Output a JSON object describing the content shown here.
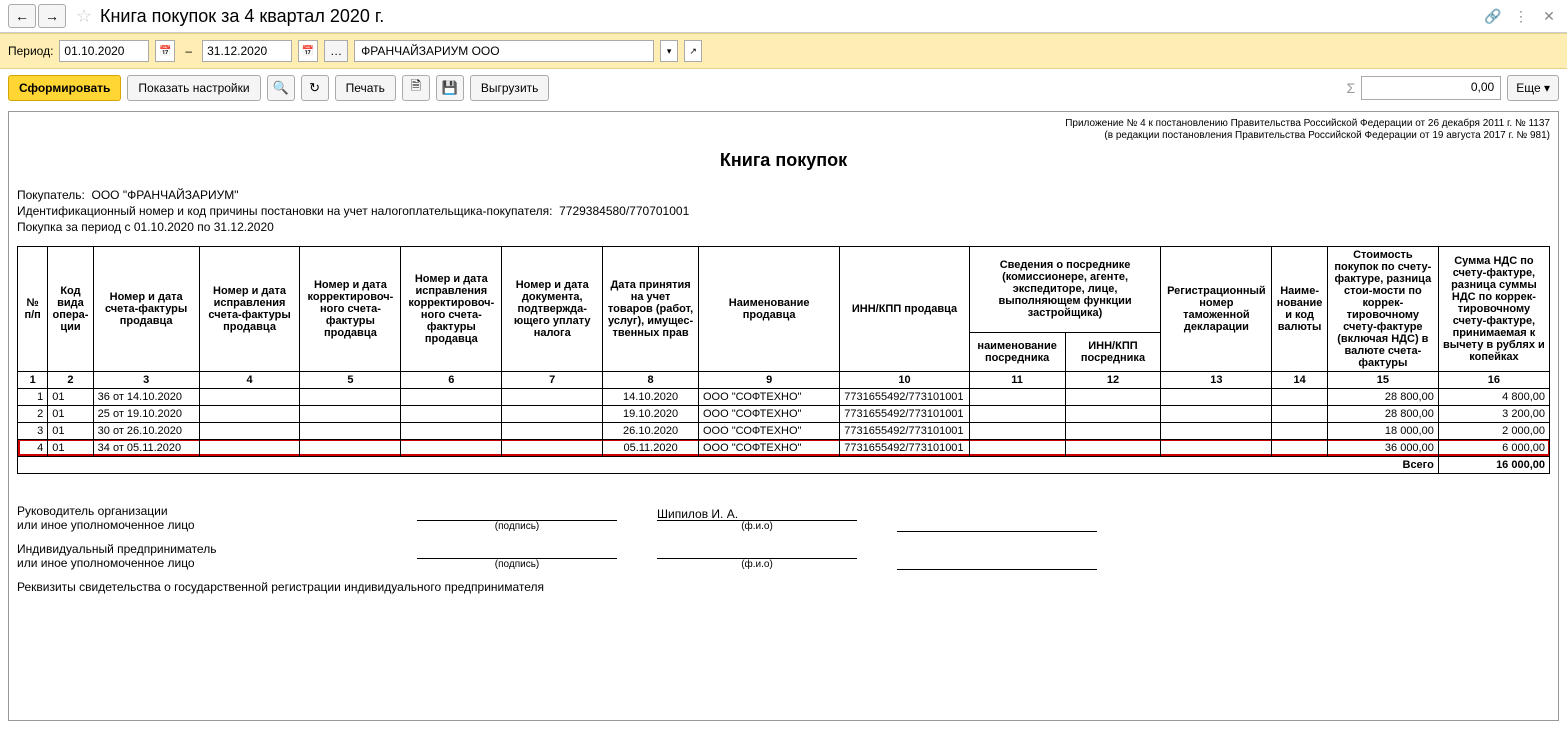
{
  "title": "Книга покупок за 4 квартал 2020 г.",
  "period": {
    "label": "Период:",
    "from": "01.10.2020",
    "to": "31.12.2020",
    "dash": "–"
  },
  "org_input": "ФРАНЧАЙЗАРИУМ ООО",
  "toolbar": {
    "form": "Сформировать",
    "show_settings": "Показать настройки",
    "print": "Печать",
    "export": "Выгрузить",
    "more": "Еще",
    "sum": "0,00"
  },
  "report": {
    "legal1": "Приложение № 4 к постановлению Правительства Российской Федерации от 26 декабря 2011 г. № 1137",
    "legal2": "(в редакции постановления Правительства Российской Федерации от 19 августа 2017 г. № 981)",
    "title": "Книга покупок",
    "buyer_label": "Покупатель:",
    "buyer": "ООО \"ФРАНЧАЙЗАРИУМ\"",
    "inn_label": "Идентификационный номер и код причины постановки на учет налогоплательщика-покупателя:",
    "inn": "7729384580/770701001",
    "period_label": "Покупка за период с 01.10.2020 по 31.12.2020",
    "headers": {
      "h1": "№ п/п",
      "h2": "Код вида опера-ции",
      "h3": "Номер и дата счета-фактуры продавца",
      "h4": "Номер и дата исправления счета-фактуры продавца",
      "h5": "Номер и дата корректировоч-ного счета-фактуры продавца",
      "h6": "Номер и дата исправления корректировоч-ного счета-фактуры продавца",
      "h7": "Номер и дата документа, подтвержда-ющего уплату налога",
      "h8": "Дата принятия на учет товаров (работ, услуг), имущес-твенных прав",
      "h9": "Наименование продавца",
      "h10": "ИНН/КПП продавца",
      "h11_12": "Сведения о посреднике (комиссионере, агенте, экспедиторе, лице, выполняющем функции застройщика)",
      "h11": "наименование посредника",
      "h12": "ИНН/КПП посредника",
      "h13": "Регистрационный номер таможенной декларации",
      "h14": "Наиме-нование и код валюты",
      "h15": "Стоимость покупок по счету-фактуре, разница стои-мости по коррек-тировочному счету-фактуре (включая НДС) в валюте счета-фактуры",
      "h16": "Сумма НДС по счету-фактуре, разница суммы НДС по коррек-тировочному счету-фактуре, принимаемая к вычету в рублях и копейках"
    },
    "colnums": [
      "1",
      "2",
      "3",
      "4",
      "5",
      "6",
      "7",
      "8",
      "9",
      "10",
      "11",
      "12",
      "13",
      "14",
      "15",
      "16"
    ],
    "rows": [
      {
        "n": "1",
        "op": "01",
        "sf": "36 от 14.10.2020",
        "date": "14.10.2020",
        "seller": "ООО \"СОФТЕХНО\"",
        "inn": "7731655492/773101001",
        "cost": "28 800,00",
        "vat": "4 800,00",
        "hl": false
      },
      {
        "n": "2",
        "op": "01",
        "sf": "25 от 19.10.2020",
        "date": "19.10.2020",
        "seller": "ООО \"СОФТЕХНО\"",
        "inn": "7731655492/773101001",
        "cost": "28 800,00",
        "vat": "3 200,00",
        "hl": false
      },
      {
        "n": "3",
        "op": "01",
        "sf": "30 от 26.10.2020",
        "date": "26.10.2020",
        "seller": "ООО \"СОФТЕХНО\"",
        "inn": "7731655492/773101001",
        "cost": "18 000,00",
        "vat": "2 000,00",
        "hl": false
      },
      {
        "n": "4",
        "op": "01",
        "sf": "34 от 05.11.2020",
        "date": "05.11.2020",
        "seller": "ООО \"СОФТЕХНО\"",
        "inn": "7731655492/773101001",
        "cost": "36 000,00",
        "vat": "6 000,00",
        "hl": true
      }
    ],
    "total_label": "Всего",
    "total_vat": "16 000,00",
    "sig": {
      "manager1": "Руководитель организации",
      "manager2": "или иное уполномоченное лицо",
      "signature": "(подпись)",
      "fio": "(ф.и.о)",
      "fio_value": "Шипилов И. А.",
      "ip1": "Индивидуальный предприниматель",
      "ip2": "или иное уполномоченное лицо",
      "requisites": "Реквизиты свидетельства о государственной регистрации индивидуального предпринимателя"
    }
  }
}
